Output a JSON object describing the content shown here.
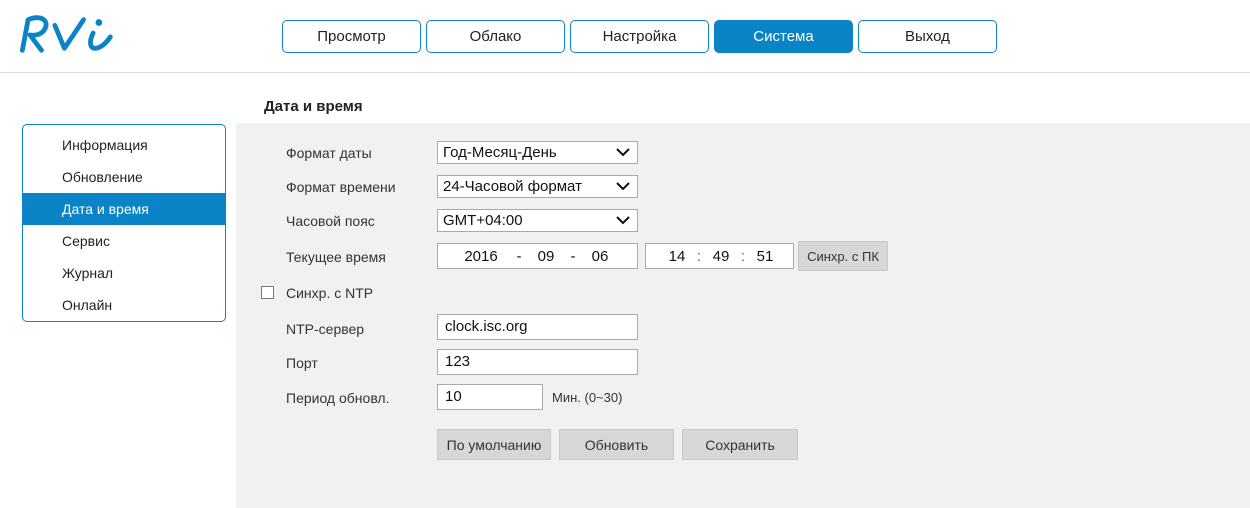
{
  "brand": {
    "logo_text": "RVi",
    "logo_color": "#0a84c6"
  },
  "nav": {
    "tabs": [
      {
        "label": "Просмотр",
        "active": false
      },
      {
        "label": "Облако",
        "active": false
      },
      {
        "label": "Настройка",
        "active": false
      },
      {
        "label": "Система",
        "active": true
      },
      {
        "label": "Выход",
        "active": false
      }
    ]
  },
  "sidebar": {
    "items": [
      {
        "label": "Информация",
        "active": false
      },
      {
        "label": "Обновление",
        "active": false
      },
      {
        "label": "Дата и время",
        "active": true
      },
      {
        "label": "Сервис",
        "active": false
      },
      {
        "label": "Журнал",
        "active": false
      },
      {
        "label": "Онлайн",
        "active": false
      }
    ]
  },
  "page": {
    "title": "Дата и время",
    "date_format": {
      "label": "Формат даты",
      "value": "Год-Месяц-День"
    },
    "time_format": {
      "label": "Формат времени",
      "value": "24-Часовой формат"
    },
    "timezone": {
      "label": "Часовой пояс",
      "value": "GMT+04:00"
    },
    "current_time": {
      "label": "Текущее время",
      "year": "2016",
      "month": "09",
      "day": "06",
      "hour": "14",
      "minute": "49",
      "second": "51",
      "date_sep": "-",
      "time_sep": ":",
      "sync_pc_label": "Синхр. с ПК"
    },
    "ntp_sync": {
      "label": "Синхр. с NTP",
      "checked": false
    },
    "ntp_server": {
      "label": "NTP-сервер",
      "value": "clock.isc.org"
    },
    "port": {
      "label": "Порт",
      "value": "123"
    },
    "period": {
      "label": "Период обновл.",
      "value": "10",
      "hint": "Мин. (0~30)"
    },
    "buttons": {
      "default": "По умолчанию",
      "refresh": "Обновить",
      "save": "Сохранить"
    }
  },
  "colors": {
    "accent": "#0a84c6",
    "panel_bg": "#f1f1f1",
    "button_bg": "#d7d7d7"
  }
}
